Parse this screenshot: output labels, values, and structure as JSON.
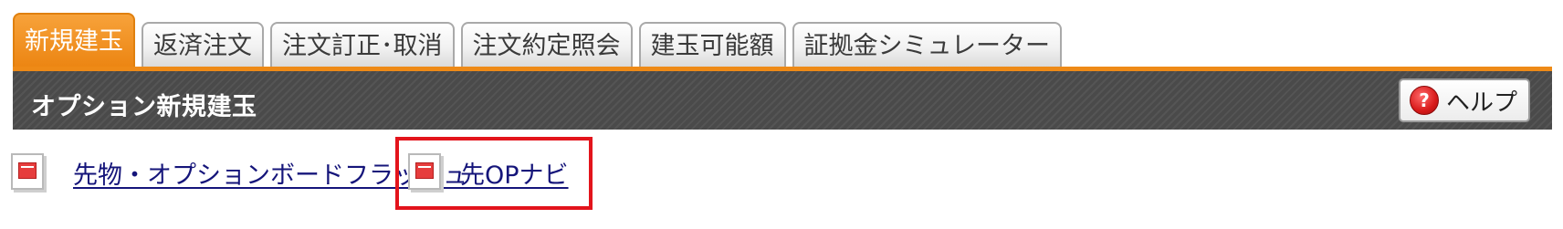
{
  "tabs": [
    {
      "label": "新規建玉",
      "active": true
    },
    {
      "label": "返済注文",
      "active": false
    },
    {
      "label": "注文訂正･取消",
      "active": false
    },
    {
      "label": "注文約定照会",
      "active": false
    },
    {
      "label": "建玉可能額",
      "active": false
    },
    {
      "label": "証拠金シミュレーター",
      "active": false
    }
  ],
  "header": {
    "title": "オプション新規建玉",
    "help_label": "ヘルプ",
    "help_icon": "question-icon"
  },
  "links": [
    {
      "label": "先物・オプションボードフラッシュ",
      "icon": "window-icon"
    },
    {
      "label": "先OPナビ",
      "icon": "window-icon",
      "highlighted": true
    }
  ],
  "colors": {
    "accent_orange": "#ee8a17",
    "header_dark": "#4a4a4a",
    "link_blue": "#15157a",
    "highlight_red": "#e3141c"
  }
}
